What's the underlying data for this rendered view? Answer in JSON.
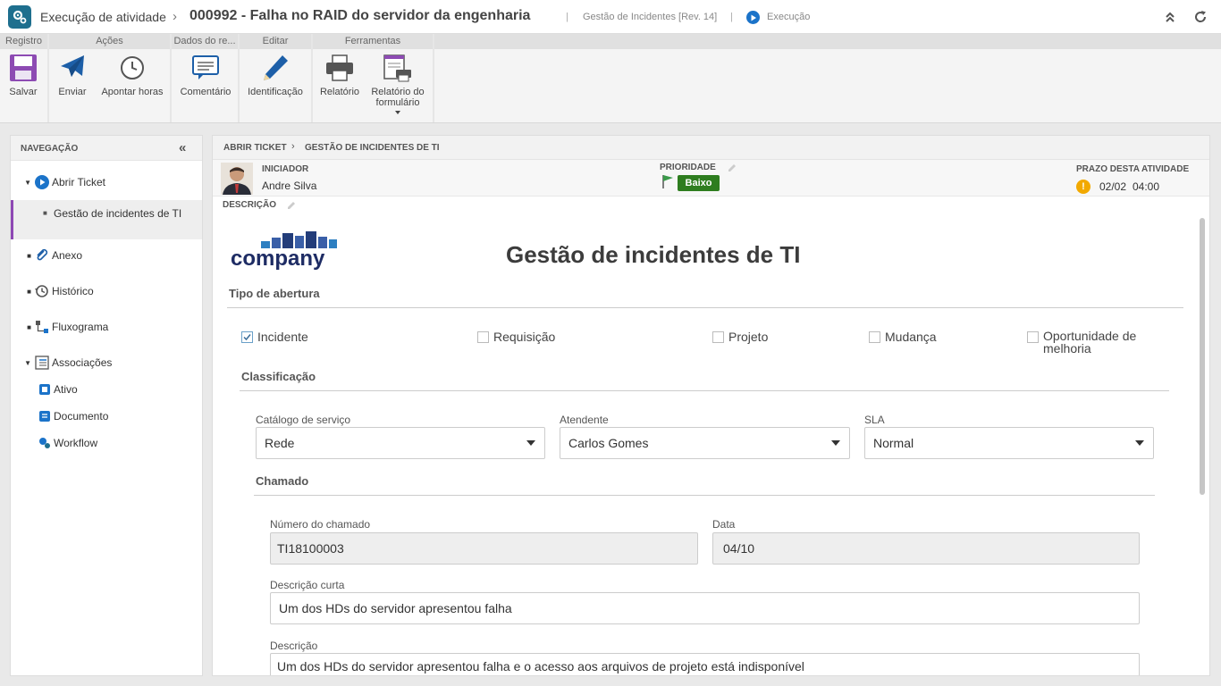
{
  "header": {
    "app_title": "Execução de atividade",
    "breadcrumb_separator": "›",
    "doc_title": "000992 - Falha no RAID do servidor da engenharia",
    "process_name": "Gestão de Incidentes [Rev. 14]",
    "status_label": "Execução"
  },
  "ribbon": {
    "groups": [
      "Registro",
      "Ações",
      "Dados do re...",
      "Editar",
      "Ferramentas"
    ],
    "buttons": {
      "save": "Salvar",
      "send": "Enviar",
      "log_hours": "Apontar horas",
      "comment": "Comentário",
      "identification": "Identificação",
      "report": "Relatório",
      "form_report": "Relatório do formulário"
    }
  },
  "nav": {
    "title": "NAVEGAÇÃO",
    "items": {
      "open_ticket": "Abrir Ticket",
      "active_sub": "Gestão de incidentes de TI",
      "attachment": "Anexo",
      "history": "Histórico",
      "flowchart": "Fluxograma",
      "associations": "Associações",
      "asset": "Ativo",
      "document": "Documento",
      "workflow": "Workflow"
    }
  },
  "main": {
    "breadcrumb": [
      "ABRIR TICKET",
      "GESTÃO DE INCIDENTES DE TI"
    ],
    "initiator_label": "INICIADOR",
    "initiator_name": "Andre Silva",
    "priority_label": "PRIORIDADE",
    "priority_value": "Baixo",
    "priority_color": "#2e7d1f",
    "deadline_label": "PRAZO DESTA ATIVIDADE",
    "deadline_date": "02/02",
    "deadline_time": "04:00",
    "description_label": "DESCRIÇÃO"
  },
  "form": {
    "logo_text": "company",
    "title": "Gestão de incidentes de TI",
    "opening_type_title": "Tipo de abertura",
    "opening_types": [
      {
        "label": "Incidente",
        "checked": true
      },
      {
        "label": "Requisição",
        "checked": false
      },
      {
        "label": "Projeto",
        "checked": false
      },
      {
        "label": "Mudança",
        "checked": false
      },
      {
        "label": "Oportunidade de melhoria",
        "checked": false
      }
    ],
    "classification_title": "Classificação",
    "service_catalog_label": "Catálogo de serviço",
    "service_catalog_value": "Rede",
    "attendant_label": "Atendente",
    "attendant_value": "Carlos Gomes",
    "sla_label": "SLA",
    "sla_value": "Normal",
    "ticket_title": "Chamado",
    "ticket_number_label": "Número do chamado",
    "ticket_number_value": "TI18100003",
    "date_label": "Data",
    "date_value": "04/10",
    "short_desc_label": "Descrição curta",
    "short_desc_value": "Um dos HDs do servidor apresentou falha",
    "desc_label": "Descrição",
    "desc_value": "Um dos HDs do servidor apresentou falha e o acesso aos arquivos de projeto está indisponível"
  }
}
